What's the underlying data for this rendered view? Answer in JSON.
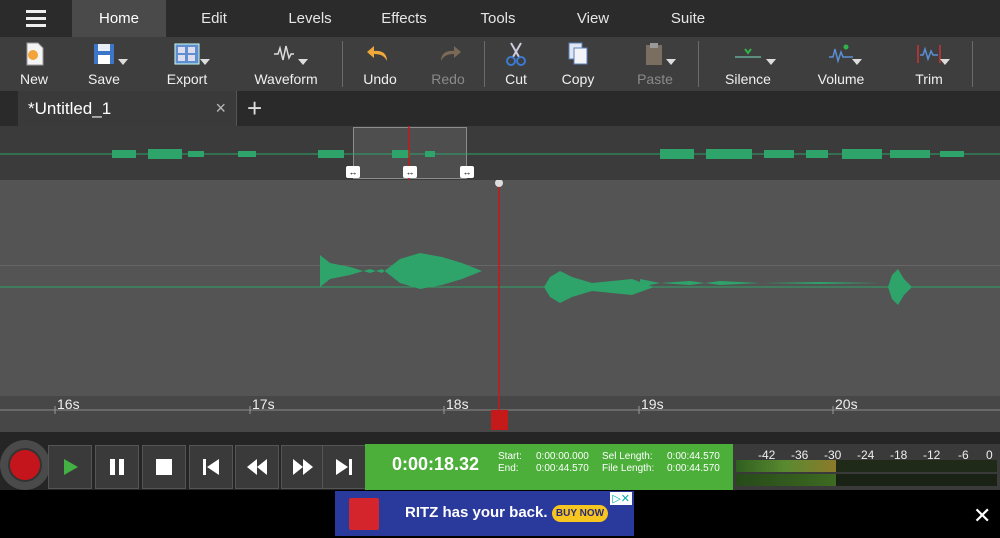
{
  "menu": {
    "tabs": [
      {
        "label": "Home"
      },
      {
        "label": "Edit"
      },
      {
        "label": "Levels"
      },
      {
        "label": "Effects"
      },
      {
        "label": "Tools"
      },
      {
        "label": "View"
      },
      {
        "label": "Suite"
      }
    ],
    "active_tab": "Home"
  },
  "toolbar": {
    "new": "New",
    "save": "Save",
    "export": "Export",
    "waveform": "Waveform",
    "undo": "Undo",
    "redo": "Redo",
    "cut": "Cut",
    "copy": "Copy",
    "paste": "Paste",
    "silence": "Silence",
    "volume": "Volume",
    "trim": "Trim"
  },
  "document_tab": {
    "title": "*Untitled_1",
    "close": "×",
    "add": "+"
  },
  "ruler": {
    "labels": [
      "16s",
      "17s",
      "18s",
      "19s",
      "20s"
    ]
  },
  "transport": {
    "current_time": "0:00:18.32",
    "start_label": "Start:",
    "start_value": "0:00:00.000",
    "end_label": "End:",
    "end_value": "0:00:44.570",
    "sel_length_label": "Sel Length:",
    "sel_length_value": "0:00:44.570",
    "file_length_label": "File Length:",
    "file_length_value": "0:00:44.570"
  },
  "meter": {
    "labels": [
      "-42",
      "-36",
      "-30",
      "-24",
      "-18",
      "-12",
      "-6",
      "0"
    ]
  },
  "ad": {
    "text": "RITZ has your back.",
    "button": "BUY NOW",
    "brand": "RITZ"
  },
  "colors": {
    "accent": "#4caf3a",
    "waveform": "#2ea36a",
    "playhead": "#c41a1a"
  }
}
